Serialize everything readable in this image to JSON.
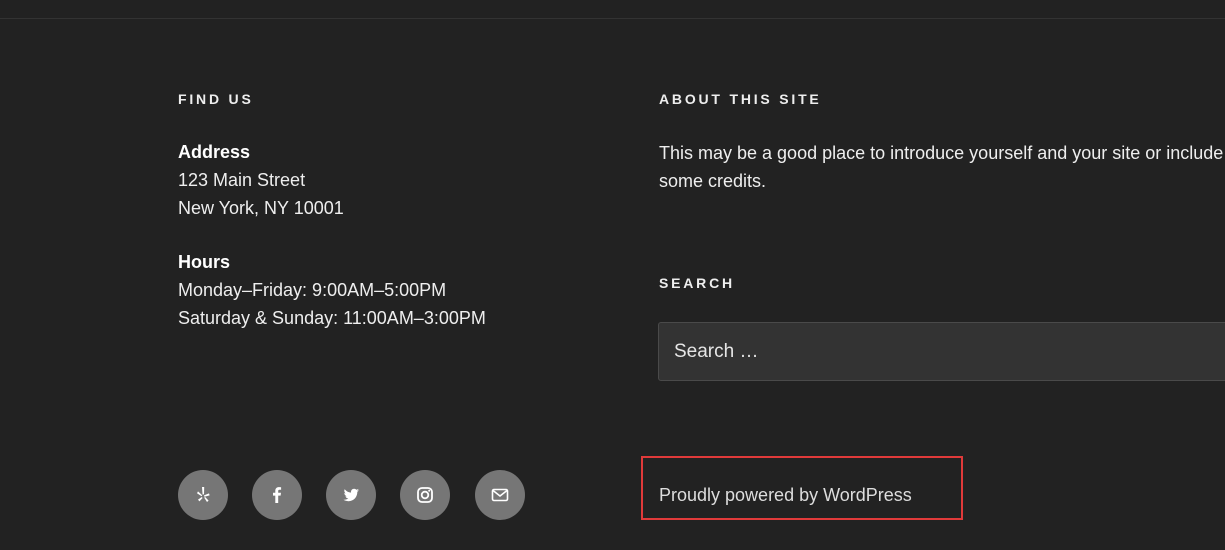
{
  "find_us": {
    "title": "Find Us",
    "address_label": "Address",
    "address_line1": "123 Main Street",
    "address_line2": "New York, NY 10001",
    "hours_label": "Hours",
    "hours_line1": "Monday–Friday: 9:00AM–5:00PM",
    "hours_line2": "Saturday & Sunday: 11:00AM–3:00PM"
  },
  "about": {
    "title": "About This Site",
    "text": "This may be a good place to introduce yourself and your site or include some credits."
  },
  "search": {
    "title": "Search",
    "placeholder": "Search …"
  },
  "social_links": [
    {
      "name": "yelp-icon",
      "label": "Yelp"
    },
    {
      "name": "facebook-icon",
      "label": "Facebook"
    },
    {
      "name": "twitter-icon",
      "label": "Twitter"
    },
    {
      "name": "instagram-icon",
      "label": "Instagram"
    },
    {
      "name": "email-icon",
      "label": "Email"
    }
  ],
  "footer": {
    "powered_by": "Proudly powered by WordPress",
    "highlight_color": "#e03a3a"
  },
  "colors": {
    "background": "#222222",
    "text": "#eeeeee",
    "social_circle": "#767676",
    "input_background": "#333333"
  }
}
